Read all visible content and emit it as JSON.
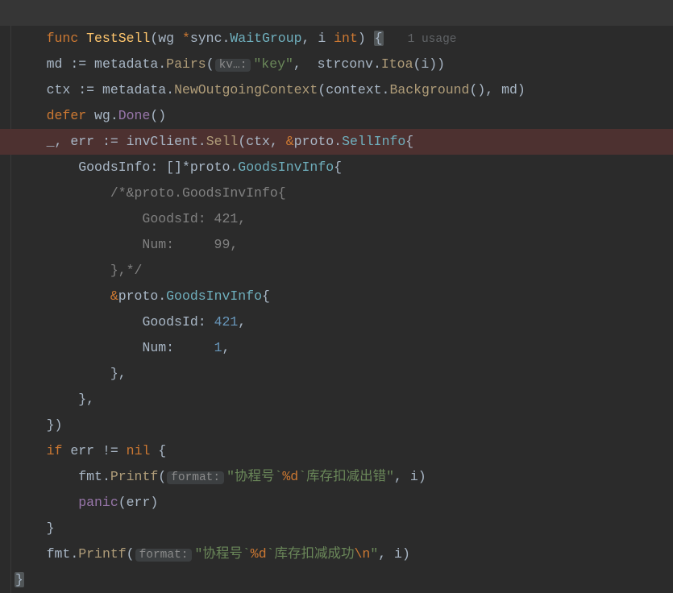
{
  "signature": {
    "func_kw": "func",
    "name": "TestSell",
    "param1_name": "wg",
    "param1_star": "*",
    "param1_pkg": "sync",
    "param1_type": "WaitGroup",
    "param2_name": "i",
    "param2_type": "int",
    "usage": "1 usage"
  },
  "line_md": {
    "var": "md",
    "op": ":=",
    "pkg": "metadata",
    "call": "Pairs",
    "hint": "kv…:",
    "key": "\"key\"",
    "strconv": "strconv",
    "itoa": "Itoa",
    "arg": "i"
  },
  "line_ctx": {
    "var": "ctx",
    "op": ":=",
    "pkg": "metadata",
    "call": "NewOutgoingContext",
    "ctx_pkg": "context",
    "bg": "Background",
    "md": "md"
  },
  "line_defer": {
    "kw": "defer",
    "wg": "wg",
    "done": "Done"
  },
  "line_sell": {
    "blank": "_",
    "err": "err",
    "op": ":=",
    "client": "invClient",
    "sell": "Sell",
    "ctx": "ctx",
    "amp": "&",
    "proto": "proto",
    "sellinfo": "SellInfo"
  },
  "line_goods": {
    "field": "GoodsInfo:",
    "arr": "[]*",
    "proto": "proto",
    "type": "GoodsInvInfo"
  },
  "comment1": "/*&proto.GoodsInvInfo{",
  "comment2": "    GoodsId: 421,",
  "comment3": "    Num:     99,",
  "comment4": "},*/",
  "line_struct": {
    "amp": "&",
    "proto": "proto",
    "type": "GoodsInvInfo"
  },
  "line_gid": {
    "field": "GoodsId: ",
    "val": "421",
    "comma": ","
  },
  "line_num": {
    "field": "Num:     ",
    "val": "1",
    "comma": ","
  },
  "brace_comma": "},",
  "brace_paren": "})",
  "line_if": {
    "kw": "if",
    "err": "err",
    "neq": "!=",
    "nil": "nil"
  },
  "line_printf_err": {
    "fmt": "fmt",
    "printf": "Printf",
    "hint": "format:",
    "str_a": "\"协程号`",
    "fmt_d": "%d",
    "str_b": "`库存扣减出错\"",
    "i": "i"
  },
  "line_panic": {
    "panic": "panic",
    "err": "err"
  },
  "line_printf_ok": {
    "fmt": "fmt",
    "printf": "Printf",
    "hint": "format:",
    "str_a": "\"协程号`",
    "fmt_d": "%d",
    "str_b": "`库存扣减成功",
    "nl": "\\n",
    "str_c": "\"",
    "i": "i"
  },
  "close_brace": "}"
}
